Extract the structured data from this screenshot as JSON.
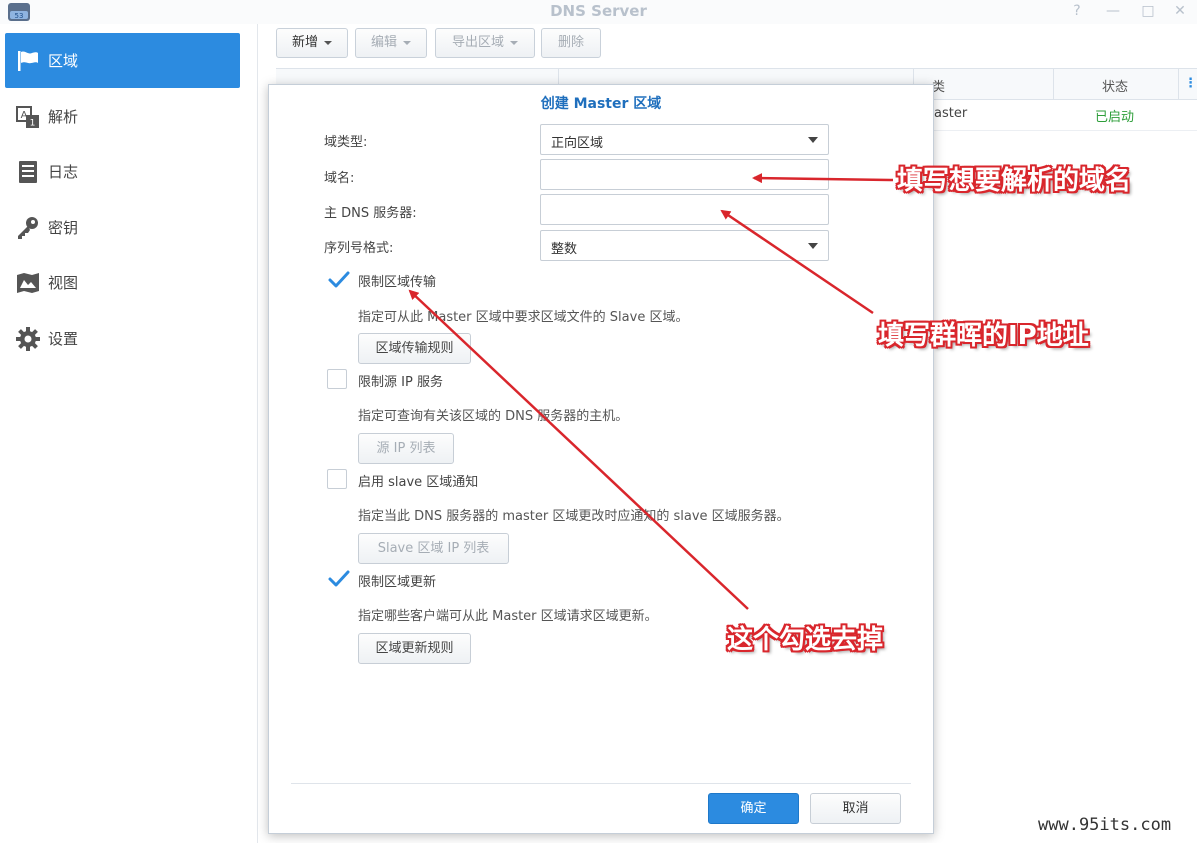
{
  "window": {
    "title": "DNS Server"
  },
  "sidebar": {
    "items": [
      {
        "label": "区域",
        "icon": "flag-icon",
        "active": true
      },
      {
        "label": "解析",
        "icon": "resolve-icon"
      },
      {
        "label": "日志",
        "icon": "log-icon"
      },
      {
        "label": "密钥",
        "icon": "key-icon"
      },
      {
        "label": "视图",
        "icon": "map-icon"
      },
      {
        "label": "设置",
        "icon": "gear-icon"
      }
    ]
  },
  "toolbar": {
    "add_label": "新增",
    "edit_label": "编辑",
    "export_label": "导出区域",
    "delete_label": "删除"
  },
  "grid": {
    "col_type_header": "类",
    "col_status_header": "状态",
    "row_type": "aster",
    "row_status": "已启动",
    "status_color": "#2e9e3a"
  },
  "dialog": {
    "title": "创建 Master 区域",
    "domain_type_label": "域类型:",
    "domain_type_value": "正向区域",
    "domain_name_label": "域名:",
    "domain_name_value": "",
    "primary_dns_label": "主 DNS 服务器:",
    "primary_dns_value": "",
    "serial_format_label": "序列号格式:",
    "serial_format_value": "整数",
    "limit_transfer_label": "限制区域传输",
    "limit_transfer_desc": "指定可从此 Master 区域中要求区域文件的 Slave 区域。",
    "limit_transfer_button": "区域传输规则",
    "limit_source_label": "限制源 IP 服务",
    "limit_source_desc": "指定可查询有关该区域的 DNS 服务器的主机。",
    "limit_source_button": "源 IP 列表",
    "slave_notify_label": "启用 slave 区域通知",
    "slave_notify_desc": "指定当此 DNS 服务器的 master 区域更改时应通知的 slave 区域服务器。",
    "slave_notify_button": "Slave 区域 IP 列表",
    "limit_update_label": "限制区域更新",
    "limit_update_desc": "指定哪些客户端可从此 Master 区域请求区域更新。",
    "limit_update_button": "区域更新规则",
    "ok_label": "确定",
    "cancel_label": "取消"
  },
  "annotations": {
    "domain_note": "填写想要解析的域名",
    "ip_note": "填写群晖的IP地址",
    "uncheck_note": "这个勾选去掉"
  },
  "watermark": "www.95its.com",
  "colors": {
    "accent": "#2c8be0",
    "annotation": "#d9262c"
  }
}
